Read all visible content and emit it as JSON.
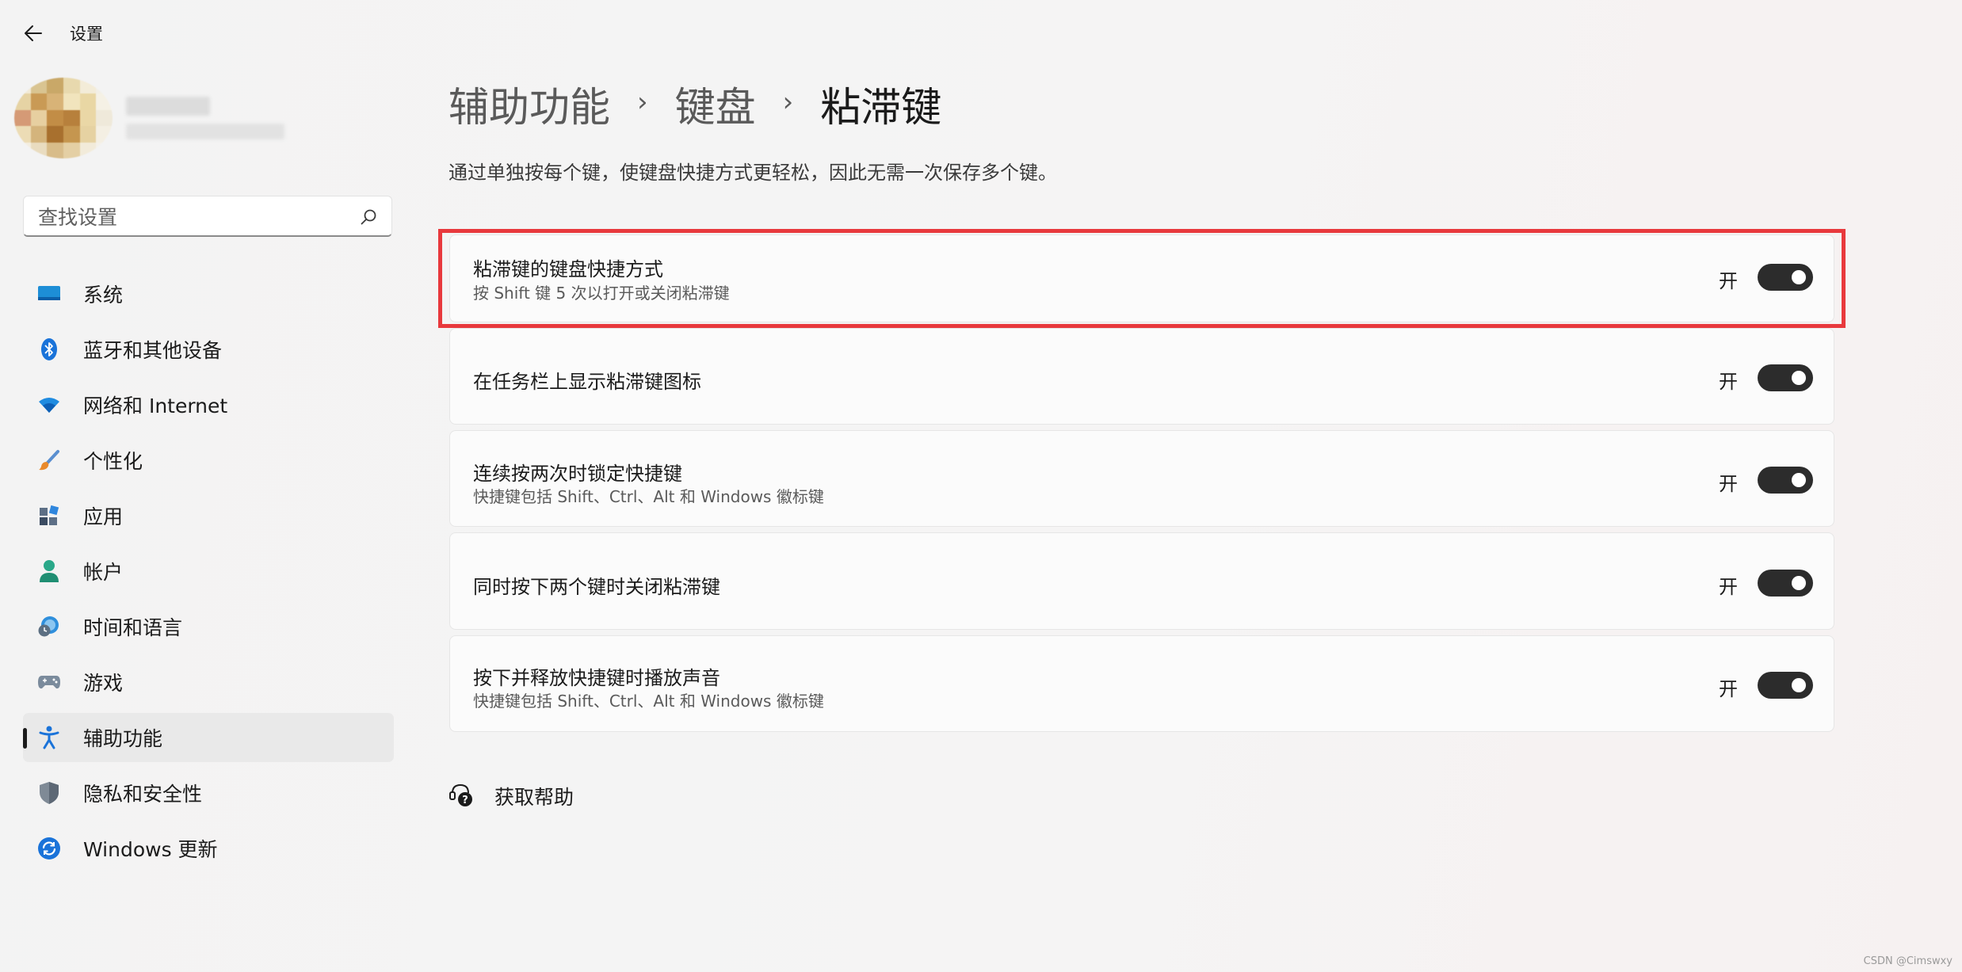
{
  "window": {
    "title": "设置"
  },
  "search": {
    "placeholder": "查找设置"
  },
  "sidebar": {
    "items": [
      {
        "label": "系统",
        "icon": "system-icon"
      },
      {
        "label": "蓝牙和其他设备",
        "icon": "bluetooth-icon"
      },
      {
        "label": "网络和 Internet",
        "icon": "wifi-icon"
      },
      {
        "label": "个性化",
        "icon": "brush-icon"
      },
      {
        "label": "应用",
        "icon": "apps-icon"
      },
      {
        "label": "帐户",
        "icon": "account-icon"
      },
      {
        "label": "时间和语言",
        "icon": "globe-clock-icon"
      },
      {
        "label": "游戏",
        "icon": "gamepad-icon"
      },
      {
        "label": "辅助功能",
        "icon": "accessibility-icon",
        "active": true
      },
      {
        "label": "隐私和安全性",
        "icon": "shield-icon"
      },
      {
        "label": "Windows 更新",
        "icon": "update-icon"
      }
    ]
  },
  "breadcrumb": {
    "items": [
      "辅助功能",
      "键盘",
      "粘滞键"
    ],
    "separator": "›"
  },
  "main": {
    "description": "通过单独按每个键，使键盘快捷方式更轻松，因此无需一次保存多个键。",
    "settings": [
      {
        "title": "粘滞键的键盘快捷方式",
        "subtitle": "按 Shift 键 5 次以打开或关闭粘滞键",
        "state": "开",
        "on": true,
        "highlighted": true
      },
      {
        "title": "在任务栏上显示粘滞键图标",
        "subtitle": "",
        "state": "开",
        "on": true
      },
      {
        "title": "连续按两次时锁定快捷键",
        "subtitle": "快捷键包括 Shift、Ctrl、Alt 和 Windows 徽标键",
        "state": "开",
        "on": true
      },
      {
        "title": "同时按下两个键时关闭粘滞键",
        "subtitle": "",
        "state": "开",
        "on": true
      },
      {
        "title": "按下并释放快捷键时播放声音",
        "subtitle": "快捷键包括 Shift、Ctrl、Alt 和 Windows 徽标键",
        "state": "开",
        "on": true
      }
    ],
    "help_label": "获取帮助"
  },
  "colors": {
    "toggle_on": "#2c2c2c",
    "highlight_border": "#e8393d",
    "accent": "#0067c0"
  },
  "watermark": "CSDN @Cimswxy"
}
